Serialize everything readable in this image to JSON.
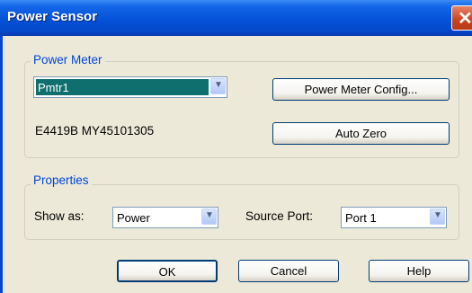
{
  "window": {
    "title": "Power Sensor"
  },
  "power_meter": {
    "legend": "Power Meter",
    "meter_select": {
      "value": "Pmtr1"
    },
    "config_button": "Power Meter Config...",
    "meter_info": "E4419B  MY45101305",
    "auto_zero_button": "Auto Zero"
  },
  "properties": {
    "legend": "Properties",
    "show_as_label": "Show as:",
    "show_as_value": "Power",
    "source_port_label": "Source Port:",
    "source_port_value": "Port 1"
  },
  "footer": {
    "ok": "OK",
    "cancel": "Cancel",
    "help": "Help"
  },
  "colors": {
    "title_bar": "#0552d8",
    "selection": "#0f6f6f",
    "group_legend": "#0046d5"
  },
  "icons": {
    "close": "close-icon",
    "dropdown": "chevron-down-icon"
  }
}
